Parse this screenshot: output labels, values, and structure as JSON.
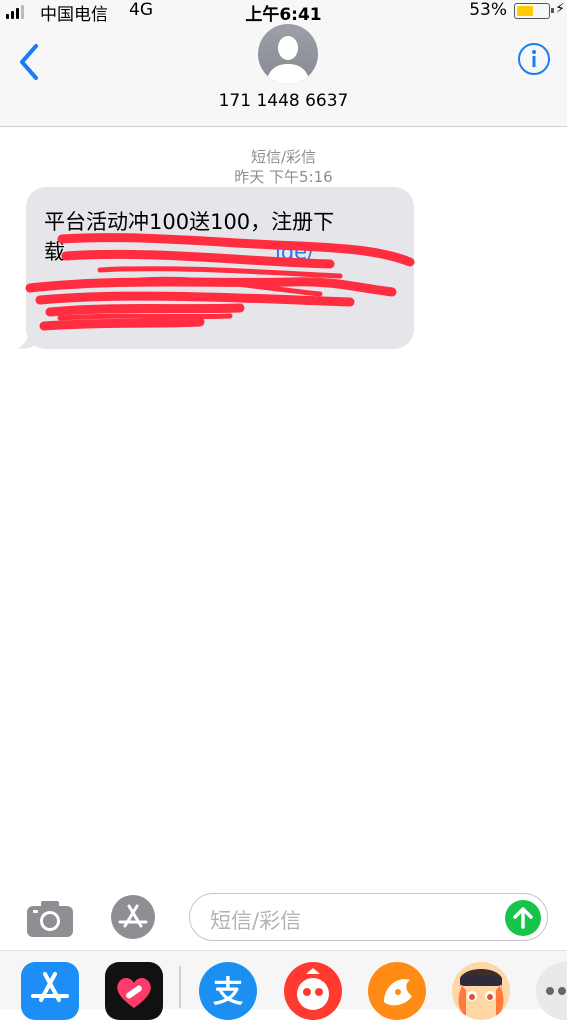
{
  "status": {
    "carrier": "中国电信",
    "network": "4G",
    "time": "上午6:41",
    "battery": "53%",
    "battery_level": 0.53
  },
  "header": {
    "contact": "171 1448 6637"
  },
  "conversation": {
    "kind": "短信/彩信",
    "timestamp": "昨天 下午5:16",
    "message": {
      "line1": "平台活动冲100送100，注册下",
      "line2_prefix": "载",
      "link_fragment": "ide/"
    }
  },
  "compose": {
    "placeholder": "短信/彩信"
  },
  "drawer": {
    "apps": [
      "app-store-icon",
      "heart-app-icon",
      "alipay-icon",
      "weibo-like-icon",
      "uc-browser-icon",
      "anime-girl-icon",
      "more-icon"
    ]
  },
  "colors": {
    "bubble": "#e5e5ea",
    "link": "#1a7cf5",
    "send": "#17c44a",
    "accent": "#1a7cf5",
    "redaction": "#ff2d3f"
  }
}
